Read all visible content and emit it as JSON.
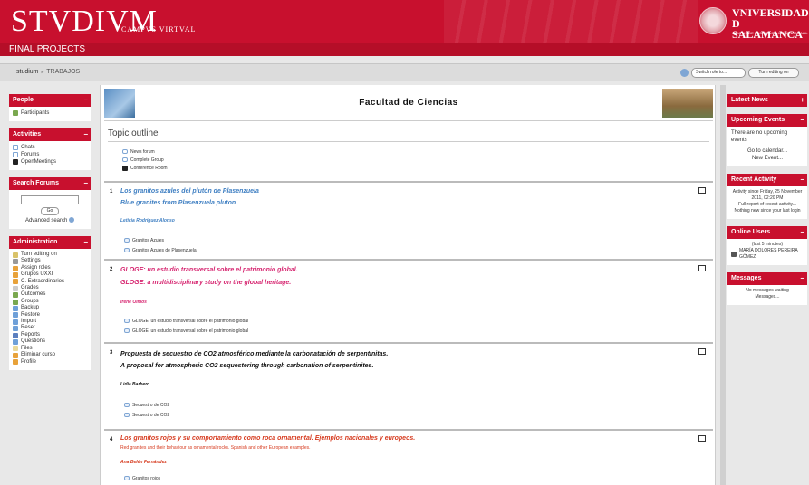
{
  "header": {
    "brand": "STVDIVM",
    "brand_sub": "CAMPVS VIRTVAL",
    "university_line1": "VNIVERSIDAD",
    "university_line2": "D SALAMANCA",
    "university_sub": "CAMPUS DE EXCELENCIA INTERNACIONAL",
    "course_title": "FINAL PROJECTS"
  },
  "navbar": {
    "breadcrumb_home": "studium",
    "breadcrumb_sep": "►",
    "breadcrumb_current": "TRABAJOS",
    "role_select": "Switch role to...",
    "edit_button": "Turn editing on"
  },
  "left": {
    "people": {
      "title": "People",
      "items": [
        "Participants"
      ]
    },
    "activities": {
      "title": "Activities",
      "items": [
        "Chats",
        "Forums",
        "OpenMeetings"
      ]
    },
    "search": {
      "title": "Search Forums",
      "go": "Go",
      "advanced": "Advanced search"
    },
    "admin": {
      "title": "Administration",
      "items": [
        "Turn editing on",
        "Settings",
        "Assign roles",
        "Grupos UXXI",
        "C. Extraordinarios",
        "Grades",
        "Outcomes",
        "Groups",
        "Backup",
        "Restore",
        "Import",
        "Reset",
        "Reports",
        "Questions",
        "Files",
        "Eliminar curso",
        "Profile"
      ]
    }
  },
  "main": {
    "banner_title": "Facultad de Ciencias",
    "outline_title": "Topic outline",
    "topic0": [
      "News forum",
      "Complete Group",
      "Conference Room"
    ],
    "sections": [
      {
        "num": "1",
        "title1": "Los granitos azules del plutón de Plasenzuela",
        "title2": "Blue granites from Plasenzuela pluton",
        "author": "Leticia Rodríguez Alonso",
        "res": [
          "Granitos Azules",
          "Granitos Azules de Plasenzuela"
        ],
        "color": "#3f7fc2"
      },
      {
        "num": "2",
        "title1": "GLOGE: un estudio transversal sobre el patrimonio global.",
        "title2": "GLOGE: a multidisciplinary study on the global heritage.",
        "author": "Irene Olmos",
        "res": [
          "GLOGE: un estudio transversal sobre el patrimonio global",
          "GLOGE: un estudio transversal sobre el patrimonio global"
        ],
        "color": "#d6246f"
      },
      {
        "num": "3",
        "title1": "Propuesta de secuestro de CO2 atmosférico mediante la carbonatación de serpentinitas.",
        "title2": "A proposal for atmospheric CO2 sequestering through carbonation of serpentinites.",
        "author": "Lidia Barbero",
        "res": [
          "Secuestro de CO2",
          "Secuestro de CO2"
        ],
        "color": "#111111"
      },
      {
        "num": "4",
        "title1": "Los granitos rojos y su comportamiento como roca ornamental. Ejemplos nacionales y europeos.",
        "title2": "Red granites and their behaviour as ornamental rocks. Spanish and other European examples.",
        "author": "Ana Belén Fernández",
        "res": [
          "Granitos rojos"
        ],
        "color": "#d63a1e"
      }
    ]
  },
  "right": {
    "news": {
      "title": "Latest News"
    },
    "events": {
      "title": "Upcoming Events",
      "text": "There are no upcoming events",
      "link1": "Go to calendar...",
      "link2": "New Event..."
    },
    "recent": {
      "title": "Recent Activity",
      "text": "Activity since Friday, 25 November 2011, 02:20 PM",
      "link": "Full report of recent activity...",
      "text2": "Nothing new since your last login"
    },
    "online": {
      "title": "Online Users",
      "text": "(last 5 minutes)",
      "user": "MARÍA DOLORES PEREIRA GÓMEZ"
    },
    "messages": {
      "title": "Messages",
      "text": "No messages waiting",
      "link": "Messages..."
    }
  },
  "colors": {
    "brand_red": "#c8102e",
    "link_blue": "#3f7fc2"
  }
}
